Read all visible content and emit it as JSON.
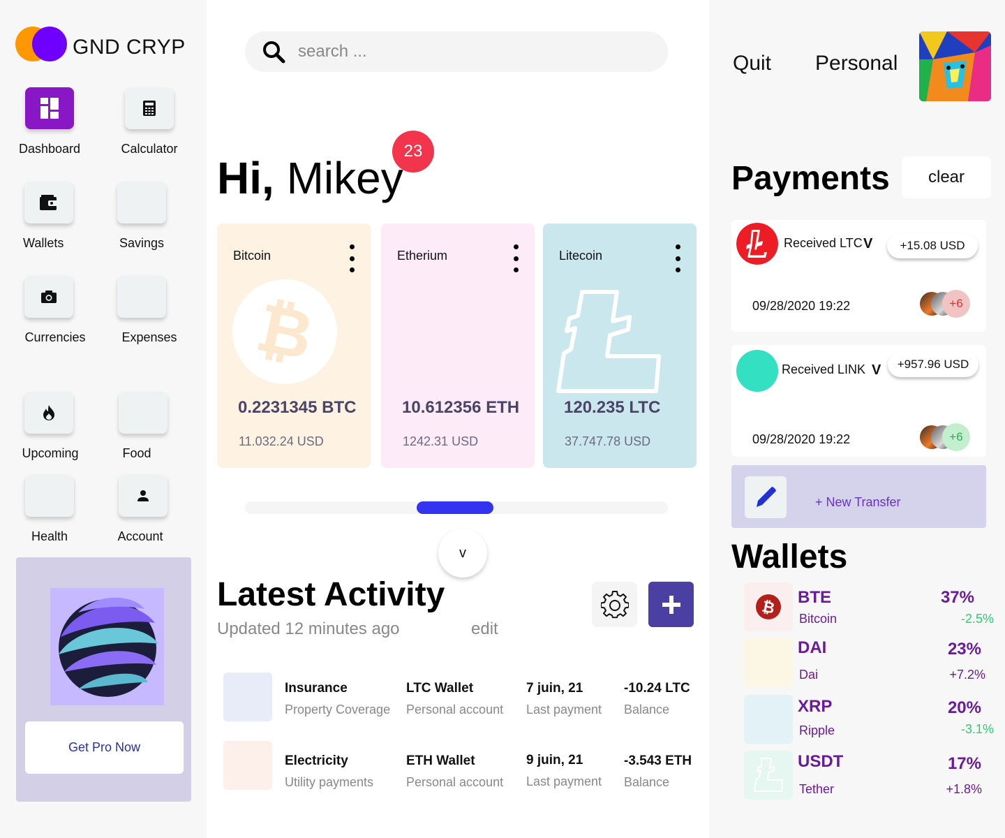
{
  "brand": {
    "name": "GND CRYP"
  },
  "sidebar": {
    "items": [
      {
        "label": "Dashboard",
        "icon": "dashboard-icon",
        "active": true
      },
      {
        "label": "Calculator",
        "icon": "calculator-icon"
      },
      {
        "label": "Wallets",
        "icon": "wallet-icon"
      },
      {
        "label": "Savings",
        "icon": ""
      },
      {
        "label": "Currencies",
        "icon": "camera-icon"
      },
      {
        "label": "Expenses",
        "icon": ""
      },
      {
        "label": "Upcoming",
        "icon": "fire-icon"
      },
      {
        "label": "Food",
        "icon": ""
      },
      {
        "label": "Health",
        "icon": ""
      },
      {
        "label": "Account",
        "icon": "user-icon"
      }
    ]
  },
  "promo": {
    "button_label": "Get Pro Now"
  },
  "search": {
    "placeholder": "search ..."
  },
  "greeting": {
    "hi": "Hi,",
    "name": " Mikey",
    "notifications": "23"
  },
  "coins": [
    {
      "name": "Bitcoin",
      "amount": "0.2231345 BTC",
      "usd": "11.032.24 USD",
      "bg": "#fef2e2"
    },
    {
      "name": "Etherium",
      "amount": "10.612356 ETH",
      "usd": "1242.31 USD",
      "bg": "#fdebf8"
    },
    {
      "name": "Litecoin",
      "amount": "120.235 LTC",
      "usd": "37.747.78 USD",
      "bg": "#c9e7ec"
    }
  ],
  "carousel": {
    "expand_label": "v"
  },
  "activity": {
    "title": "Latest Activity",
    "updated": "Updated 12 minutes ago",
    "edit_label": "edit",
    "rows": [
      {
        "thumb": "#e7ecf8",
        "title": "Insurance",
        "subtitle": "Property Coverage",
        "wallet": "LTC Wallet",
        "wallet_sub": "Personal account",
        "date": "7 juin, 21",
        "date_sub": "Last payment",
        "amount": "-10.24 LTC",
        "amount_sub": "Balance"
      },
      {
        "thumb": "#fdf0ea",
        "title": "Electricity",
        "subtitle": "Utility payments",
        "wallet": "ETH Wallet",
        "wallet_sub": "Personal account",
        "date": "9 juin, 21",
        "date_sub": "Last payment",
        "amount": "-3.543 ETH",
        "amount_sub": "Balance"
      }
    ]
  },
  "header": {
    "quit_label": "Quit",
    "personal_label": "Personal"
  },
  "payments": {
    "title": "Payments",
    "clear_label": "clear",
    "items": [
      {
        "label": "Received LTC",
        "chevron": "V",
        "amount": "+15.08 USD",
        "date": "09/28/2020 19:22",
        "more": "+6",
        "more_color": "#d8342f",
        "more_bg": "#f2c3c3",
        "icon_color": "#ee1c24"
      },
      {
        "label": "Received LINK",
        "chevron": "V",
        "amount": "+957.96 USD",
        "date": "09/28/2020 19:22",
        "more": "+6",
        "more_color": "#2fa857",
        "more_bg": "#c4efcf",
        "icon_color": "#33e0c2"
      }
    ],
    "new_transfer_label": "+ New Transfer"
  },
  "wallets": {
    "title": "Wallets",
    "items": [
      {
        "symbol": "BTE",
        "name": "Bitcoin",
        "pct": "37%",
        "change": "-2.5%",
        "change_color": "#2ecc71",
        "thumb": "#fbeeee"
      },
      {
        "symbol": "DAI",
        "name": "Dai",
        "pct": "23%",
        "change": "+7.2%",
        "change_color": "#6a1b9a",
        "thumb": "#fbf7e4"
      },
      {
        "symbol": "XRP",
        "name": "Ripple",
        "pct": "20%",
        "change": "-3.1%",
        "change_color": "#2ecc71",
        "thumb": "#e3f2f7"
      },
      {
        "symbol": "USDT",
        "name": "Tether",
        "pct": "17%",
        "change": "+1.8%",
        "change_color": "#6a1b9a",
        "thumb": "#e6f7f2"
      }
    ]
  },
  "colors": {
    "accent": "#8a17c5",
    "primary_button": "#4b3fa4",
    "scroll_thumb": "#3333f0",
    "badge": "#f2344c"
  }
}
